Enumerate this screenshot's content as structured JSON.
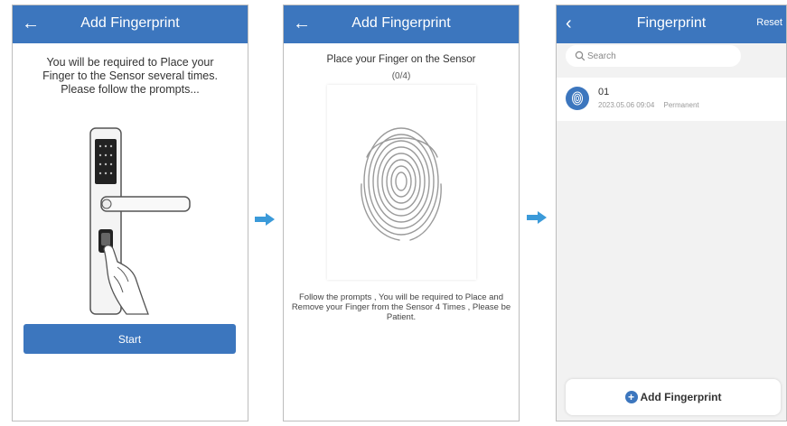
{
  "screen1": {
    "title": "Add Fingerprint",
    "intro": "You will be required to Place your Finger to the Sensor several times. Please follow the prompts...",
    "start_label": "Start"
  },
  "screen2": {
    "title": "Add Fingerprint",
    "instruction": "Place your Finger on the Sensor",
    "progress": "(0/4)",
    "follow_text": "Follow the prompts , You will be required to Place and Remove your Finger from the Sensor 4 Times , Please be Patient."
  },
  "screen3": {
    "title": "Fingerprint",
    "reset_label": "Reset",
    "search_placeholder": "Search",
    "fingerprints": [
      {
        "name": "01",
        "date": "2023.05.06 09:04",
        "type": "Permanent"
      }
    ],
    "add_label": "Add Fingerprint"
  },
  "icons": {
    "back": "back-arrow-icon",
    "search": "search-icon",
    "fingerprint": "fingerprint-icon",
    "add": "plus-circle-icon",
    "flow": "right-arrow-icon"
  },
  "colors": {
    "header": "#3c76be",
    "accent": "#3c76be",
    "flow_arrow": "#3b9ad9",
    "list_background": "#f2f2f2"
  }
}
